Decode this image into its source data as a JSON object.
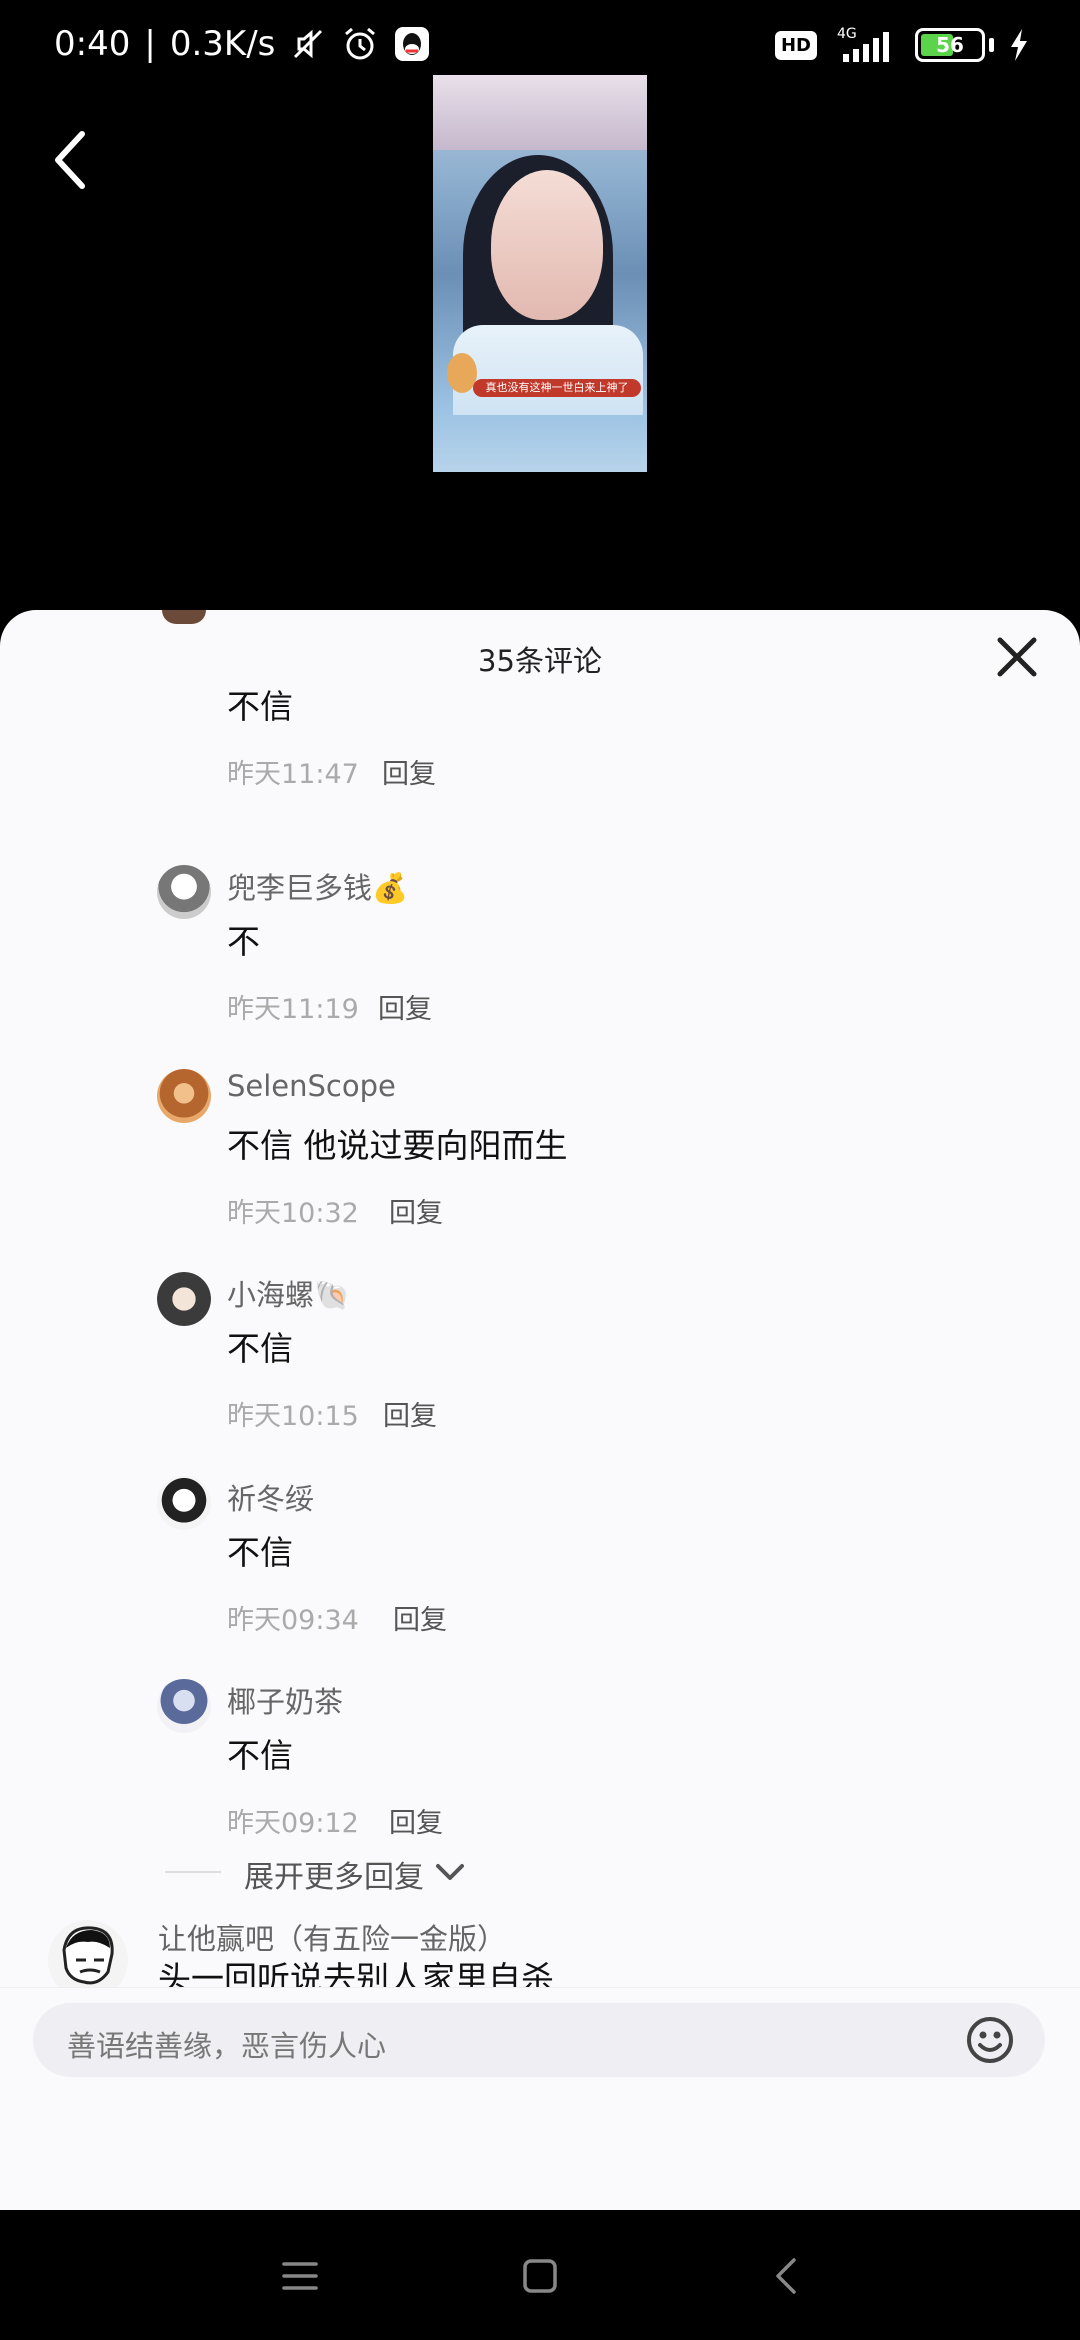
{
  "status_bar": {
    "time": "0:40",
    "separator": "|",
    "speed": "0.3K/s",
    "hd": "HD",
    "network": "4G",
    "battery": "56",
    "battery_level": 0.56
  },
  "video": {
    "caption": "真也没有这神一世白来上神了"
  },
  "sheet": {
    "title": "35条评论"
  },
  "replies": [
    {
      "name": "",
      "text": "不信",
      "time": "昨天11:47",
      "reply_label": "回复"
    },
    {
      "name": "兜李巨多钱💰",
      "text": "不",
      "time": "昨天11:19",
      "reply_label": "回复"
    },
    {
      "name": "SelenScope",
      "text": "不信 他说过要向阳而生",
      "time": "昨天10:32",
      "reply_label": "回复"
    },
    {
      "name": "小海螺🐚",
      "text": "不信",
      "time": "昨天10:15",
      "reply_label": "回复"
    },
    {
      "name": "祈冬绥",
      "text": "不信",
      "time": "昨天09:34",
      "reply_label": "回复"
    },
    {
      "name": "椰子奶茶",
      "text": "不信",
      "time": "昨天09:12",
      "reply_label": "回复"
    }
  ],
  "expand": {
    "label": "展开更多回复"
  },
  "top_comment": {
    "name": "让他赢吧（有五险一金版）",
    "text": "头一回听说去别人家里自杀"
  },
  "input": {
    "placeholder": "善语结善缘，恶言伤人心"
  },
  "colors": {
    "sheet_bg": "#fafafc",
    "accent_caption": "#c0392b"
  }
}
